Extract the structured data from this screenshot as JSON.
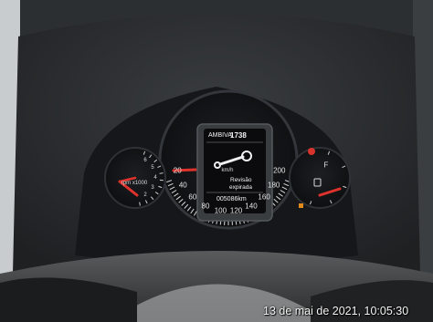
{
  "speedometer": {
    "ticks": [
      "20",
      "40",
      "60",
      "80",
      "100",
      "120",
      "140",
      "160",
      "180",
      "200"
    ],
    "unit": "km/h"
  },
  "tachometer": {
    "ticks": [
      "2",
      "3",
      "4",
      "5",
      "6"
    ],
    "unit": "rpm x1000"
  },
  "fuel_gauge": {
    "full_label": "F"
  },
  "lcd": {
    "trip_label": "AMBIVA",
    "trip_value": "1738",
    "message_line1": "Revisão",
    "message_line2": "expirada",
    "odometer": "005086km"
  },
  "overlay": {
    "timestamp": "13 de mai de 2021, 10:05:30"
  },
  "colors": {
    "needle": "#e0322c",
    "dial_face": "#121417",
    "lcd_screen": "#0b0b0d",
    "dashboard": "#2a2d30"
  }
}
